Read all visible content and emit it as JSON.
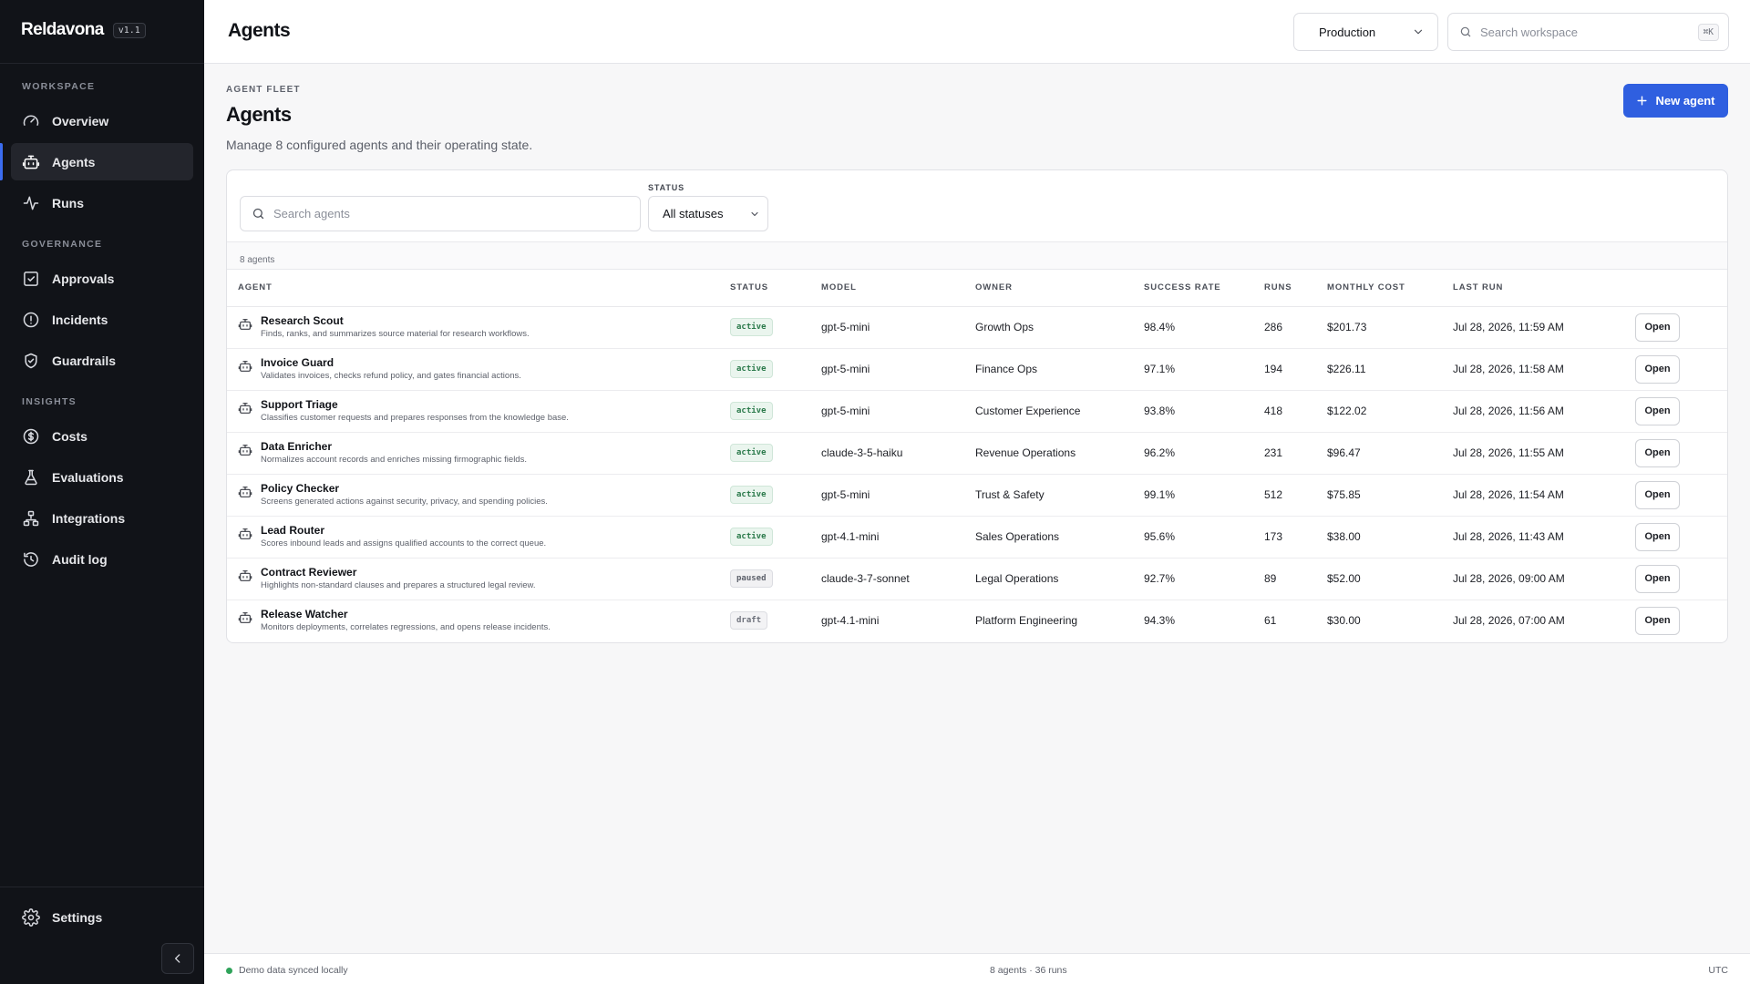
{
  "app": {
    "name": "Reldavona",
    "version": "v1.1"
  },
  "sidebar": {
    "sections": [
      {
        "label": "WORKSPACE",
        "items": [
          {
            "label": "Overview",
            "icon": "gauge-icon"
          },
          {
            "label": "Agents",
            "icon": "bot-icon",
            "active": true
          },
          {
            "label": "Runs",
            "icon": "activity-icon"
          }
        ]
      },
      {
        "label": "GOVERNANCE",
        "items": [
          {
            "label": "Approvals",
            "icon": "check-square-icon"
          },
          {
            "label": "Incidents",
            "icon": "alert-circle-icon"
          },
          {
            "label": "Guardrails",
            "icon": "shield-check-icon"
          }
        ]
      },
      {
        "label": "INSIGHTS",
        "items": [
          {
            "label": "Costs",
            "icon": "dollar-circle-icon"
          },
          {
            "label": "Evaluations",
            "icon": "flask-icon"
          },
          {
            "label": "Integrations",
            "icon": "network-icon"
          },
          {
            "label": "Audit log",
            "icon": "history-icon"
          }
        ]
      }
    ],
    "settings_label": "Settings"
  },
  "topbar": {
    "title": "Agents",
    "environment": "Production",
    "search_placeholder": "Search workspace",
    "shortcut": "⌘K"
  },
  "page": {
    "eyebrow": "AGENT FLEET",
    "title": "Agents",
    "description": "Manage 8 configured agents and their operating state.",
    "new_button": "New agent"
  },
  "filters": {
    "search_placeholder": "Search agents",
    "status_label": "STATUS",
    "status_value": "All statuses"
  },
  "table": {
    "count_label": "8 agents",
    "columns": [
      "AGENT",
      "STATUS",
      "MODEL",
      "OWNER",
      "SUCCESS RATE",
      "RUNS",
      "MONTHLY COST",
      "LAST RUN",
      ""
    ],
    "action_label": "Open",
    "rows": [
      {
        "name": "Research Scout",
        "description": "Finds, ranks, and summarizes source material for research workflows.",
        "status": "active",
        "model": "gpt-5-mini",
        "owner": "Growth Ops",
        "success_rate": "98.4%",
        "runs": "286",
        "monthly_cost": "$201.73",
        "last_run": "Jul 28, 2026, 11:59 AM"
      },
      {
        "name": "Invoice Guard",
        "description": "Validates invoices, checks refund policy, and gates financial actions.",
        "status": "active",
        "model": "gpt-5-mini",
        "owner": "Finance Ops",
        "success_rate": "97.1%",
        "runs": "194",
        "monthly_cost": "$226.11",
        "last_run": "Jul 28, 2026, 11:58 AM"
      },
      {
        "name": "Support Triage",
        "description": "Classifies customer requests and prepares responses from the knowledge base.",
        "status": "active",
        "model": "gpt-5-mini",
        "owner": "Customer Experience",
        "success_rate": "93.8%",
        "runs": "418",
        "monthly_cost": "$122.02",
        "last_run": "Jul 28, 2026, 11:56 AM"
      },
      {
        "name": "Data Enricher",
        "description": "Normalizes account records and enriches missing firmographic fields.",
        "status": "active",
        "model": "claude-3-5-haiku",
        "owner": "Revenue Operations",
        "success_rate": "96.2%",
        "runs": "231",
        "monthly_cost": "$96.47",
        "last_run": "Jul 28, 2026, 11:55 AM"
      },
      {
        "name": "Policy Checker",
        "description": "Screens generated actions against security, privacy, and spending policies.",
        "status": "active",
        "model": "gpt-5-mini",
        "owner": "Trust & Safety",
        "success_rate": "99.1%",
        "runs": "512",
        "monthly_cost": "$75.85",
        "last_run": "Jul 28, 2026, 11:54 AM"
      },
      {
        "name": "Lead Router",
        "description": "Scores inbound leads and assigns qualified accounts to the correct queue.",
        "status": "active",
        "model": "gpt-4.1-mini",
        "owner": "Sales Operations",
        "success_rate": "95.6%",
        "runs": "173",
        "monthly_cost": "$38.00",
        "last_run": "Jul 28, 2026, 11:43 AM"
      },
      {
        "name": "Contract Reviewer",
        "description": "Highlights non-standard clauses and prepares a structured legal review.",
        "status": "paused",
        "model": "claude-3-7-sonnet",
        "owner": "Legal Operations",
        "success_rate": "92.7%",
        "runs": "89",
        "monthly_cost": "$52.00",
        "last_run": "Jul 28, 2026, 09:00 AM"
      },
      {
        "name": "Release Watcher",
        "description": "Monitors deployments, correlates regressions, and opens release incidents.",
        "status": "draft",
        "model": "gpt-4.1-mini",
        "owner": "Platform Engineering",
        "success_rate": "94.3%",
        "runs": "61",
        "monthly_cost": "$30.00",
        "last_run": "Jul 28, 2026, 07:00 AM"
      }
    ]
  },
  "footer": {
    "sync": "Demo data synced locally",
    "summary": "8 agents · 36 runs",
    "timezone": "UTC"
  },
  "colors": {
    "accent": "#2f5fe0",
    "sidebar": "#111318",
    "success": "#2fa35a"
  }
}
